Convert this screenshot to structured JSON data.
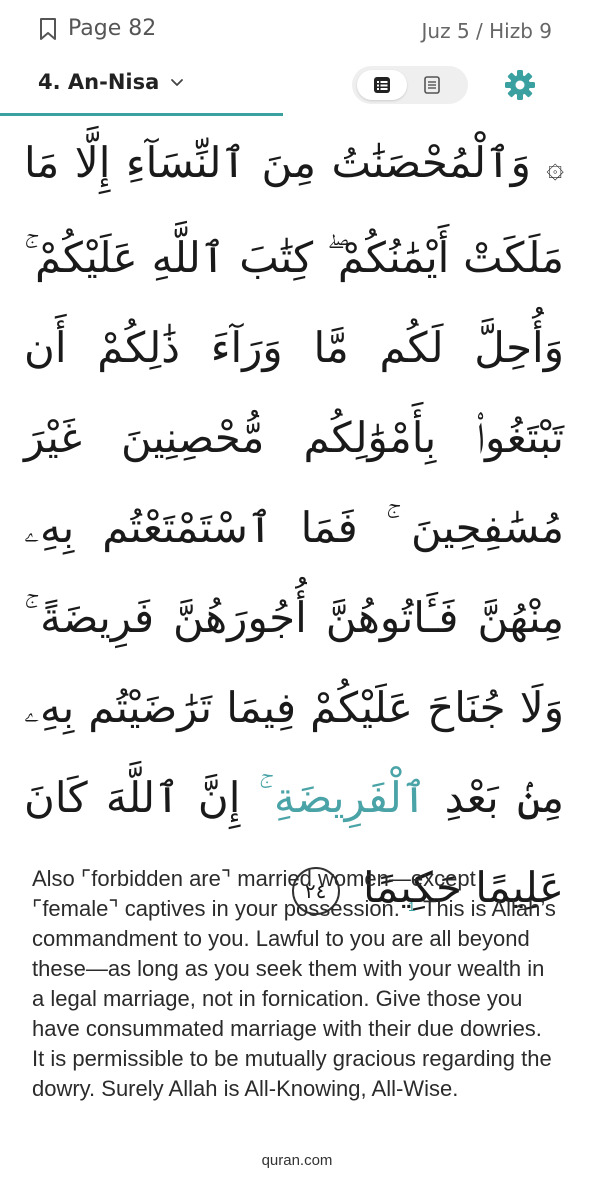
{
  "header": {
    "page_label": "Page 82",
    "juz_hizb": "Juz 5 / Hizb 9",
    "chapter": "4. An-Nisa"
  },
  "icons": {
    "bookmark": "bookmark-icon",
    "chevron": "chevron-down-icon",
    "reading_mode": "list-view-icon",
    "translation_mode": "document-icon",
    "settings": "gear-icon"
  },
  "colors": {
    "accent": "#3aa0a0",
    "highlight_word": "#4aa3a6"
  },
  "verse": {
    "marker": "۞",
    "lines": [
      "وَٱلْمُحْصَنَٰتُ مِنَ ٱلنِّسَآءِ إِلَّا مَا",
      "مَلَكَتْ أَيْمَٰنُكُمْ ۖ كِتَٰبَ ٱللَّهِ",
      "عَلَيْكُمْ ۚ وَأُحِلَّ لَكُم مَّا وَرَآءَ ذَٰلِكُمْ أَن",
      "تَبْتَغُوا۟ بِأَمْوَٰلِكُم مُّحْصِنِينَ غَيْرَ",
      "مُسَٰفِحِينَ ۚ فَمَا ٱسْتَمْتَعْتُم بِهِۦ مِنْهُنَّ",
      "فَـَٔاتُوهُنَّ أُجُورَهُنَّ فَرِيضَةً ۚ وَلَا جُنَاحَ",
      "عَلَيْكُمْ فِيمَا تَرَٰضَيْتُم بِهِۦ مِنۢ بَعْدِ"
    ],
    "highlighted_word": "ٱلْفَرِيضَةِ ۚ",
    "line8_rest": "إِنَّ ٱللَّهَ كَانَ عَلِيمًا",
    "last_line": "حَكِيمًا",
    "ayah_number": "٢٤"
  },
  "translation": {
    "part1": "Also ⌜forbidden are⌝ married women—except ⌜female⌝ captives in your possession.",
    "footnote_mark": "1",
    "part2": "This is Allah’s commandment to you. Lawful to you are all beyond these—as long as you seek them with your wealth in a legal marriage, not in fornication. Give those you have consummated marriage with their due dowries. It is permissible to be mutually gracious regarding the dowry. Surely Allah is All-Knowing, All-Wise."
  },
  "watermark": "quran.com"
}
